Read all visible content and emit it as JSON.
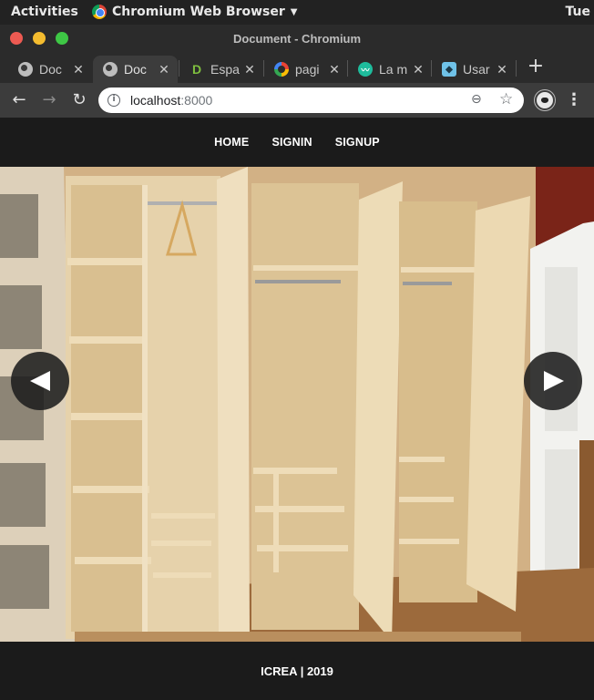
{
  "system_bar": {
    "activities": "Activities",
    "app_name": "Chromium Web Browser",
    "clock": "Tue"
  },
  "window": {
    "title": "Document - Chromium"
  },
  "tabs": [
    {
      "label": "Doc",
      "icon": "globe-icon",
      "active": false
    },
    {
      "label": "Doc",
      "icon": "globe-icon",
      "active": true
    },
    {
      "label": "Espa",
      "icon": "d-letter-icon",
      "active": false
    },
    {
      "label": "pagi",
      "icon": "google-icon",
      "active": false
    },
    {
      "label": "La m",
      "icon": "teal-chart-icon",
      "active": false
    },
    {
      "label": "Usar",
      "icon": "bird-icon",
      "active": false
    }
  ],
  "toolbar": {
    "url_host": "localhost",
    "url_port": ":8000"
  },
  "site": {
    "nav": [
      "HOME",
      "SIGNIN",
      "SIGNUP"
    ],
    "footer": "ICREA | 2019"
  },
  "carousel": {
    "prev_icon": "chevron-left-icon",
    "next_icon": "chevron-right-icon"
  },
  "colors": {
    "page_bg": "#1b1b1b",
    "arrow_bg": "#1e1e1e",
    "wood": "#e3cfa6"
  }
}
